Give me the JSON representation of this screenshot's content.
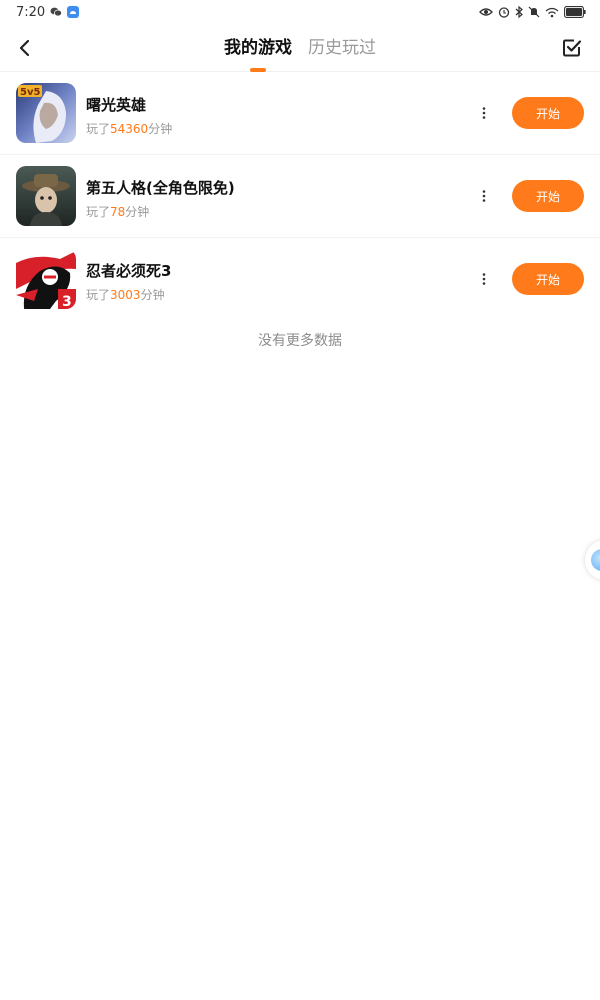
{
  "status_bar": {
    "time": "7:20",
    "battery": "99"
  },
  "header": {
    "tabs": [
      {
        "label": "我的游戏",
        "active": true
      },
      {
        "label": "历史玩过",
        "active": false
      }
    ]
  },
  "games": [
    {
      "name": "曙光英雄",
      "played_prefix": "玩了",
      "minutes": "54360",
      "unit": "分钟",
      "start_label": "开始",
      "icon_colors": [
        "#5b6fa8",
        "#a9b6df"
      ]
    },
    {
      "name": "第五人格(全角色限免)",
      "played_prefix": "玩了",
      "minutes": "78",
      "unit": "分钟",
      "start_label": "开始",
      "icon_colors": [
        "#3e4a45",
        "#8a8f7a"
      ]
    },
    {
      "name": "忍者必须死3",
      "played_prefix": "玩了",
      "minutes": "3003",
      "unit": "分钟",
      "start_label": "开始",
      "icon_colors": [
        "#d8202a",
        "#ffffff"
      ]
    }
  ],
  "footer_text": "没有更多数据",
  "colors": {
    "accent": "#ff7a1a",
    "muted": "#9a9a9a"
  }
}
